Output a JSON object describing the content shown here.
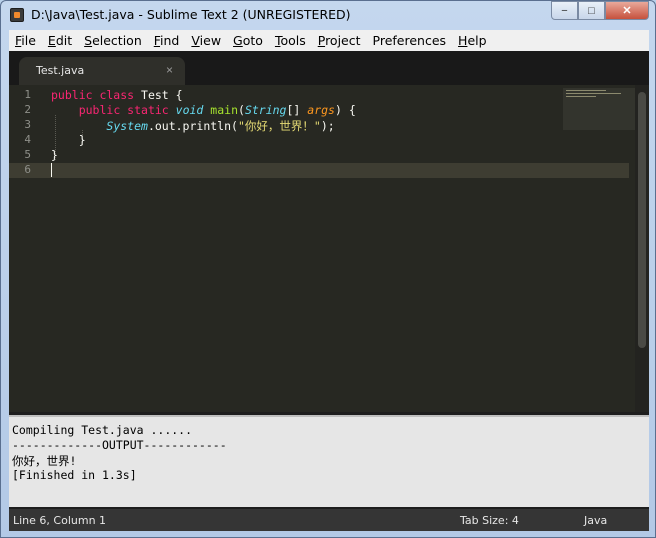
{
  "window": {
    "title": "D:\\Java\\Test.java - Sublime Text 2 (UNREGISTERED)",
    "minimize": "−",
    "maximize": "□",
    "close": "✕"
  },
  "menu": [
    {
      "label": "File",
      "ul": "F",
      "rest": "ile"
    },
    {
      "label": "Edit",
      "ul": "E",
      "rest": "dit"
    },
    {
      "label": "Selection",
      "ul": "S",
      "rest": "election"
    },
    {
      "label": "Find",
      "ul": "F",
      "rest": "ind"
    },
    {
      "label": "View",
      "ul": "V",
      "rest": "iew"
    },
    {
      "label": "Goto",
      "ul": "G",
      "rest": "oto"
    },
    {
      "label": "Tools",
      "ul": "T",
      "rest": "ools"
    },
    {
      "label": "Project",
      "ul": "P",
      "rest": "roject"
    },
    {
      "label": "Preferences",
      "ul": "",
      "rest": "Preferences"
    },
    {
      "label": "Help",
      "ul": "H",
      "rest": "elp"
    }
  ],
  "tab": {
    "label": "Test.java",
    "close": "×"
  },
  "code": {
    "line_numbers": [
      "1",
      "2",
      "3",
      "4",
      "5",
      "6"
    ],
    "lines": [
      [
        {
          "t": "public class",
          "c": "kw"
        },
        {
          "t": " Test {",
          "c": ""
        }
      ],
      [
        {
          "t": "    ",
          "c": ""
        },
        {
          "t": "public static",
          "c": "kw"
        },
        {
          "t": " ",
          "c": ""
        },
        {
          "t": "void",
          "c": "type"
        },
        {
          "t": " ",
          "c": ""
        },
        {
          "t": "main",
          "c": "fn"
        },
        {
          "t": "(",
          "c": ""
        },
        {
          "t": "String",
          "c": "type"
        },
        {
          "t": "[] ",
          "c": ""
        },
        {
          "t": "args",
          "c": "arg"
        },
        {
          "t": ") {",
          "c": ""
        }
      ],
      [
        {
          "t": "        ",
          "c": ""
        },
        {
          "t": "System",
          "c": "type"
        },
        {
          "t": ".out.println(",
          "c": ""
        },
        {
          "t": "\"你好，世界！\"",
          "c": "str"
        },
        {
          "t": ");",
          "c": ""
        }
      ],
      [
        {
          "t": "    }",
          "c": ""
        }
      ],
      [
        {
          "t": "}",
          "c": ""
        }
      ],
      [
        {
          "t": "",
          "c": ""
        }
      ]
    ],
    "current_line": 6
  },
  "console": {
    "lines": [
      "Compiling Test.java ......",
      "-------------OUTPUT------------",
      "你好，世界!",
      "[Finished in 1.3s]"
    ]
  },
  "status": {
    "position": "Line 6, Column 1",
    "tab_size": "Tab Size: 4",
    "syntax": "Java"
  },
  "colors": {
    "background": "#272822",
    "keyword": "#f92672",
    "type": "#66d9ef",
    "function": "#a6e22e",
    "string": "#e6db74",
    "argument": "#fd971f"
  }
}
